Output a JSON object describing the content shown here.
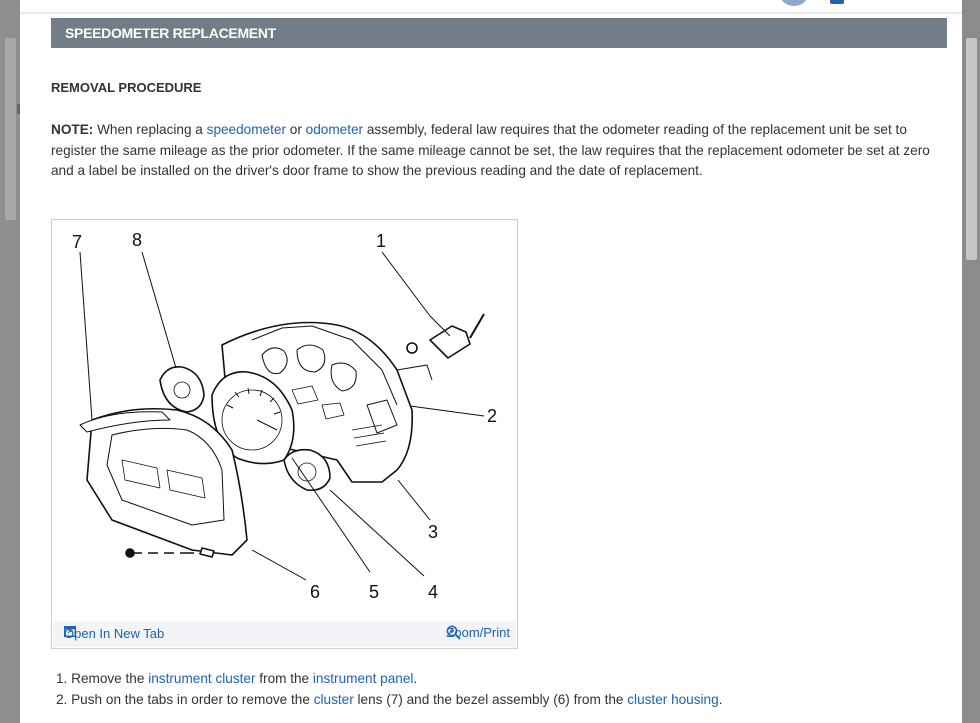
{
  "header": {
    "title": "SPEEDOMETER REPLACEMENT"
  },
  "section": {
    "title": "REMOVAL PROCEDURE"
  },
  "note": {
    "label": "NOTE:",
    "t1": " When replacing a ",
    "link1": "speedometer",
    "t2": " or ",
    "link2": "odometer",
    "t3": " assembly, federal law requires that the odometer reading of the replacement unit be set to register the same mileage as the prior odometer. If the same mileage cannot be set, the law requires that the replacement odometer be set at zero and a label be installed on the driver's door frame to show the previous reading and the date of replacement."
  },
  "figure": {
    "callouts": [
      "1",
      "2",
      "3",
      "4",
      "5",
      "6",
      "7",
      "8"
    ],
    "open_tab": "Open In New Tab",
    "zoom_print": "Zoom/Print"
  },
  "steps": [
    {
      "num": "1.",
      "t1": " Remove the ",
      "l1": "instrument cluster",
      "t2": " from the ",
      "l2": "instrument panel",
      "t3": "."
    },
    {
      "num": "2.",
      "t1": " Push on the tabs in order to remove the ",
      "l1": "cluster",
      "t2": " lens (7) and the bezel assembly (6) from the ",
      "l2": "cluster housing",
      "t3": "."
    }
  ],
  "colors": {
    "banner": "#737d87",
    "link": "#1f62b0"
  }
}
